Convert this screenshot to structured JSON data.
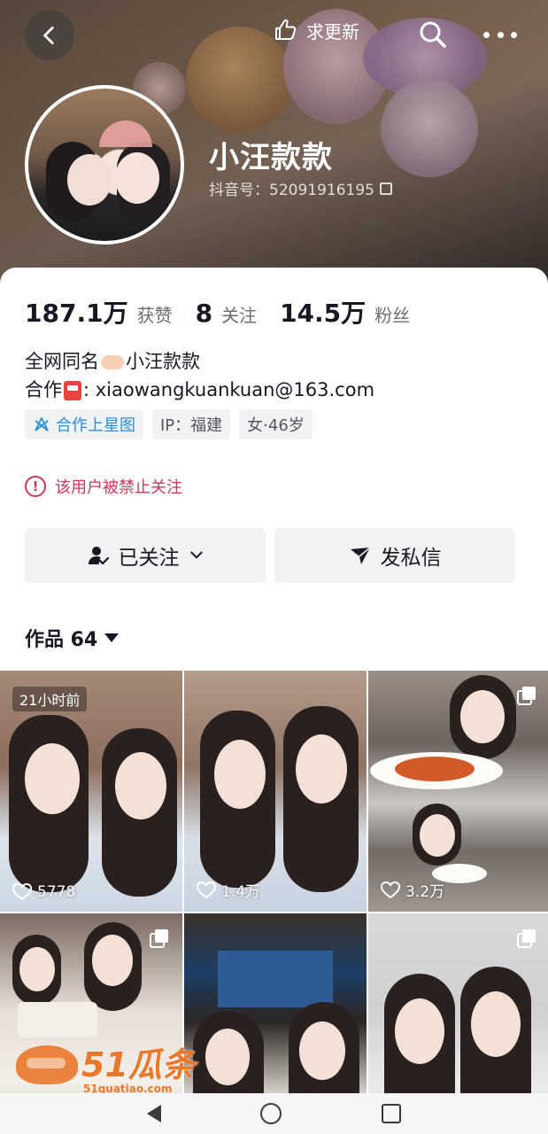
{
  "header": {
    "update_label": "求更新",
    "username": "小汪款款",
    "douyin_id": "抖音号：52091916195"
  },
  "stats": [
    {
      "value": "187.1万",
      "label": "获赞"
    },
    {
      "value": "8",
      "label": "关注"
    },
    {
      "value": "14.5万",
      "label": "粉丝"
    }
  ],
  "bio": {
    "line1_prefix": "全网同名",
    "line1_suffix": "小汪款款",
    "line2_prefix": "合作",
    "line2_suffix": ": xiaowangkuankuan@163.com"
  },
  "tags": {
    "star": "合作上星图",
    "ip": "IP：福建",
    "gender_age": "女·46岁"
  },
  "warning": "该用户被禁止关注",
  "actions": {
    "followed": "已关注",
    "message": "发私信"
  },
  "works": {
    "label": "作品 64"
  },
  "videos": [
    {
      "time": "21小时前",
      "likes": "5778",
      "multi": false
    },
    {
      "time": "",
      "likes": "1.4万",
      "multi": false
    },
    {
      "time": "",
      "likes": "3.2万",
      "multi": true
    },
    {
      "time": "",
      "likes": "",
      "multi": true
    },
    {
      "time": "",
      "likes": "",
      "multi": false
    },
    {
      "time": "",
      "likes": "",
      "multi": true
    }
  ],
  "watermark": {
    "text": "51瓜条",
    "sub": "51guatiao.com"
  },
  "colors": {
    "warning": "#d6335a",
    "star_tag": "#2a8fd6",
    "watermark": "#e9782b"
  }
}
